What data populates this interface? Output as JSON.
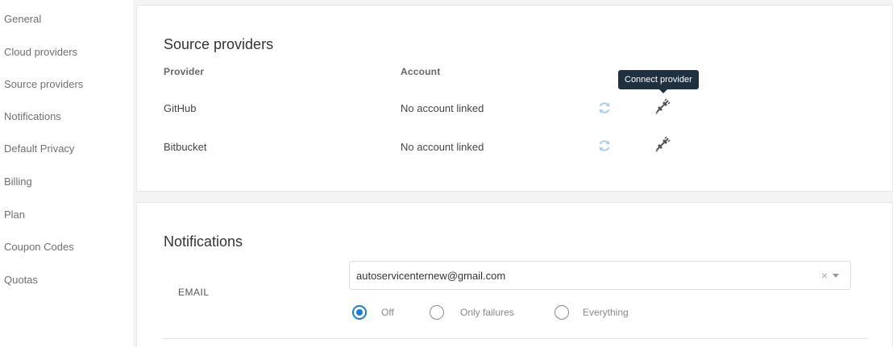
{
  "sidebar": {
    "items": [
      {
        "label": "General"
      },
      {
        "label": "Cloud providers"
      },
      {
        "label": "Source providers"
      },
      {
        "label": "Notifications"
      },
      {
        "label": "Default Privacy"
      },
      {
        "label": "Billing"
      },
      {
        "label": "Plan"
      },
      {
        "label": "Coupon Codes"
      },
      {
        "label": "Quotas"
      }
    ]
  },
  "source_providers": {
    "title": "Source providers",
    "columns": {
      "provider": "Provider",
      "account": "Account"
    },
    "rows": [
      {
        "provider": "GitHub",
        "account": "No account linked"
      },
      {
        "provider": "Bitbucket",
        "account": "No account linked"
      }
    ],
    "tooltip": "Connect provider",
    "icons": {
      "sync": "sync-icon",
      "connect": "unplugged-icon"
    },
    "colors": {
      "sync": "#a9cfe8",
      "connect": "#555555"
    }
  },
  "notifications": {
    "title": "Notifications",
    "email_label": "EMAIL",
    "email_value": "autoservicenternew@gmail.com",
    "clear_symbol": "×",
    "options": [
      {
        "label": "Off",
        "checked": true
      },
      {
        "label": "Only failures",
        "checked": false
      },
      {
        "label": "Everything",
        "checked": false
      }
    ],
    "accent": "#1a7fd4"
  }
}
